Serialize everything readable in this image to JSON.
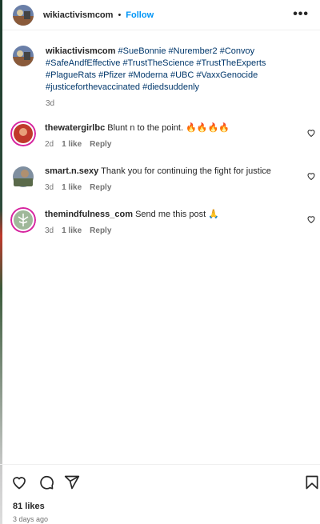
{
  "header": {
    "username": "wikiactivismcom",
    "separator": "•",
    "follow_label": "Follow",
    "more_label": "•••"
  },
  "caption": {
    "username": "wikiactivismcom",
    "hashtags": [
      "#SueBonnie",
      "#Nurember2",
      "#Convoy",
      "#SafeAndfEffective",
      "#TrustTheScience",
      "#TrustTheExperts",
      "#PlagueRats",
      "#Pfizer",
      "#Moderna",
      "#UBC",
      "#VaxxGenocide",
      "#justiceforthevaccinated",
      "#diedsuddenly"
    ],
    "time": "3d"
  },
  "comments": [
    {
      "username": "thewatergirlbc",
      "text": "Blunt n to the point. 🔥🔥🔥🔥",
      "time": "2d",
      "likes": "1 like",
      "reply": "Reply"
    },
    {
      "username": "smart.n.sexy",
      "text": "Thank you for continuing the fight for justice",
      "time": "3d",
      "likes": "1 like",
      "reply": "Reply"
    },
    {
      "username": "themindfulness_com",
      "text": "Send me this post 🙏",
      "time": "3d",
      "likes": "1 like",
      "reply": "Reply"
    }
  ],
  "footer": {
    "likes": "81 likes",
    "date": "3 days ago"
  },
  "icons": {
    "like": "heart-icon",
    "comment": "comment-icon",
    "share": "share-icon",
    "save": "bookmark-icon"
  }
}
